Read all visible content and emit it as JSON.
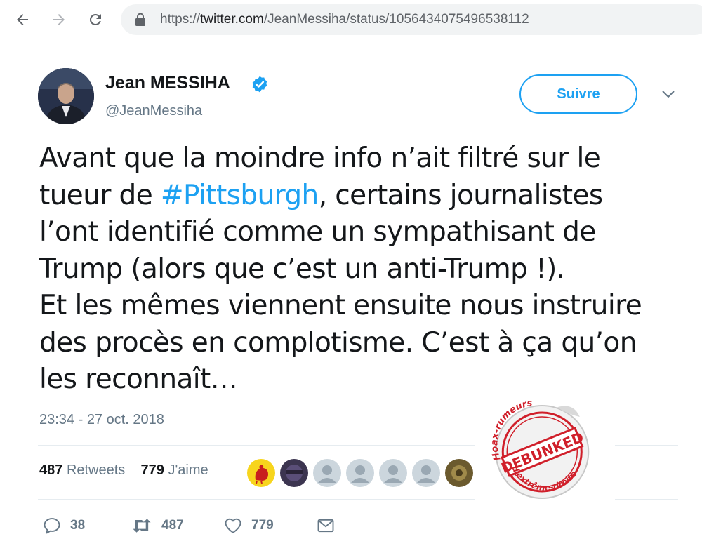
{
  "browser": {
    "url_prefix": "https://",
    "url_host": "twitter.com",
    "url_path": "/JeanMessiha/status/1056434075496538112"
  },
  "tweet": {
    "display_name": "Jean MESSIHA",
    "handle": "@JeanMessiha",
    "follow_label": "Suivre",
    "text_lines": {
      "l1": "Avant que la moindre info n’ait filtré sur le",
      "l2_pre": "tueur de ",
      "l2_hashtag": "#Pittsburgh",
      "l2_post": ", certains journalistes",
      "l3": "l’ont identifié comme un sympathisant de",
      "l4": "Trump (alors que c’est un anti-Trump !).",
      "l5": "Et les mêmes viennent ensuite nous instruire",
      "l6": "des procès en complotisme.  C’est à ça qu’on",
      "l7": "les reconnaît…"
    },
    "timestamp": "23:34 - 27 oct. 2018",
    "stats": {
      "retweets_count": "487",
      "retweets_label": "Retweets",
      "likes_count": "779",
      "likes_label": "J'aime"
    },
    "actions": {
      "reply_count": "38",
      "retweet_count": "487",
      "like_count": "779"
    }
  },
  "sticker": {
    "top_text": "Hoax-rumeurs",
    "main_text": "DEBUNKED",
    "bottom_text": "d'extrême-droite"
  },
  "colors": {
    "accent": "#1da1f2",
    "secondary_text": "#657786",
    "stamp_red": "#d01f2a"
  }
}
